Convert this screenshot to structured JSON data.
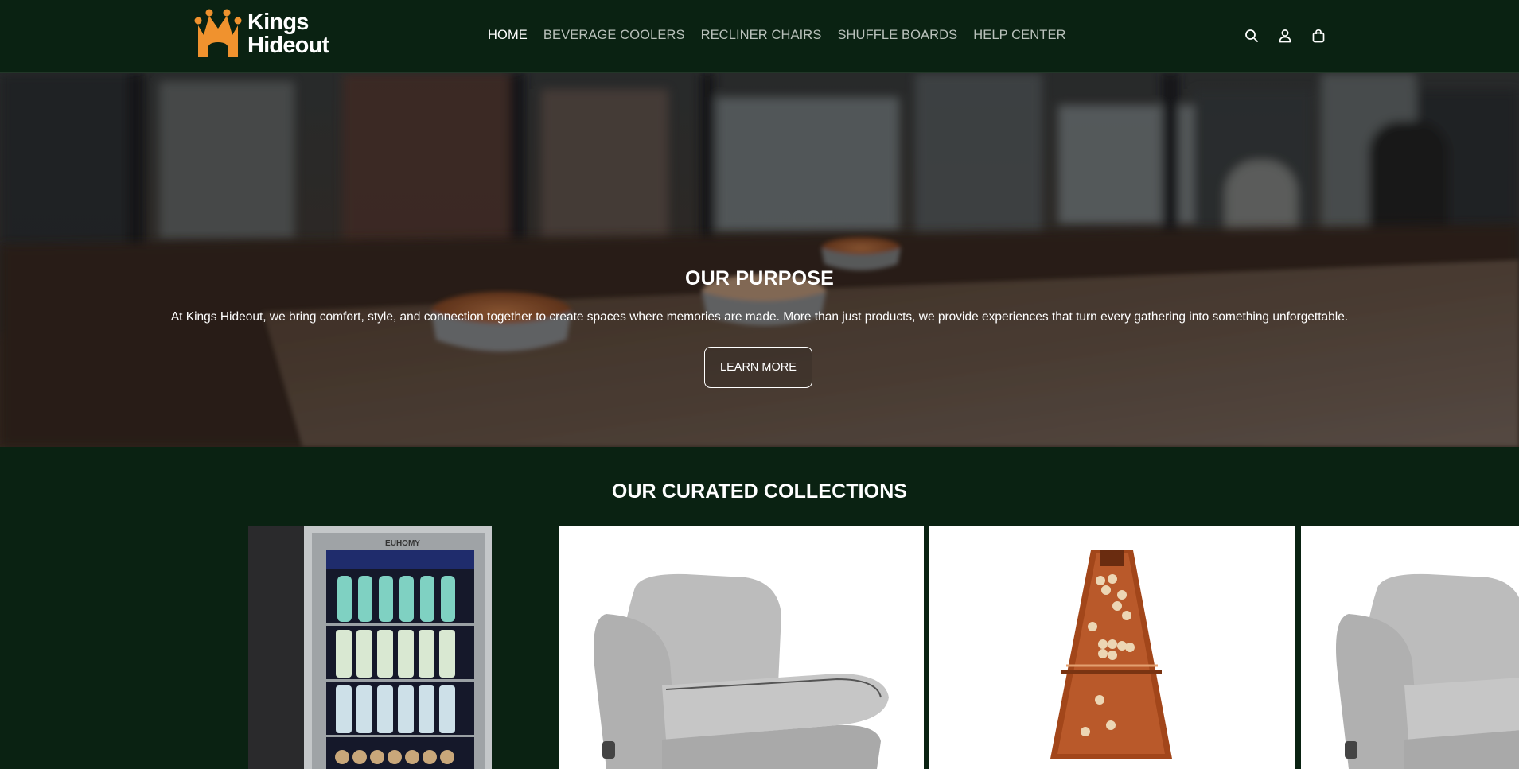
{
  "header": {
    "brand": {
      "line1": "Kings",
      "line2": "Hideout",
      "accent_color": "#f0922e"
    },
    "nav": [
      {
        "label": "HOME",
        "active": true
      },
      {
        "label": "BEVERAGE COOLERS",
        "active": false
      },
      {
        "label": "RECLINER CHAIRS",
        "active": false
      },
      {
        "label": "SHUFFLE BOARDS",
        "active": false
      },
      {
        "label": "HELP CENTER",
        "active": false
      }
    ],
    "icons": [
      "search-icon",
      "account-icon",
      "cart-icon"
    ],
    "background_color": "#0a2212"
  },
  "hero": {
    "title": "OUR PURPOSE",
    "text": "At Kings Hideout, we bring comfort, style, and connection together to create spaces where memories are made. More than just products, we provide experiences that turn every gathering into something unforgettable.",
    "button_label": "LEARN MORE"
  },
  "collections": {
    "title": "OUR CURATED COLLECTIONS",
    "cards": [
      {
        "product": "beverage-cooler",
        "brand_label": "EUHOMY"
      },
      {
        "product": "recliner-chair"
      },
      {
        "product": "shuffleboard"
      },
      {
        "product": "recliner-chair"
      }
    ]
  }
}
